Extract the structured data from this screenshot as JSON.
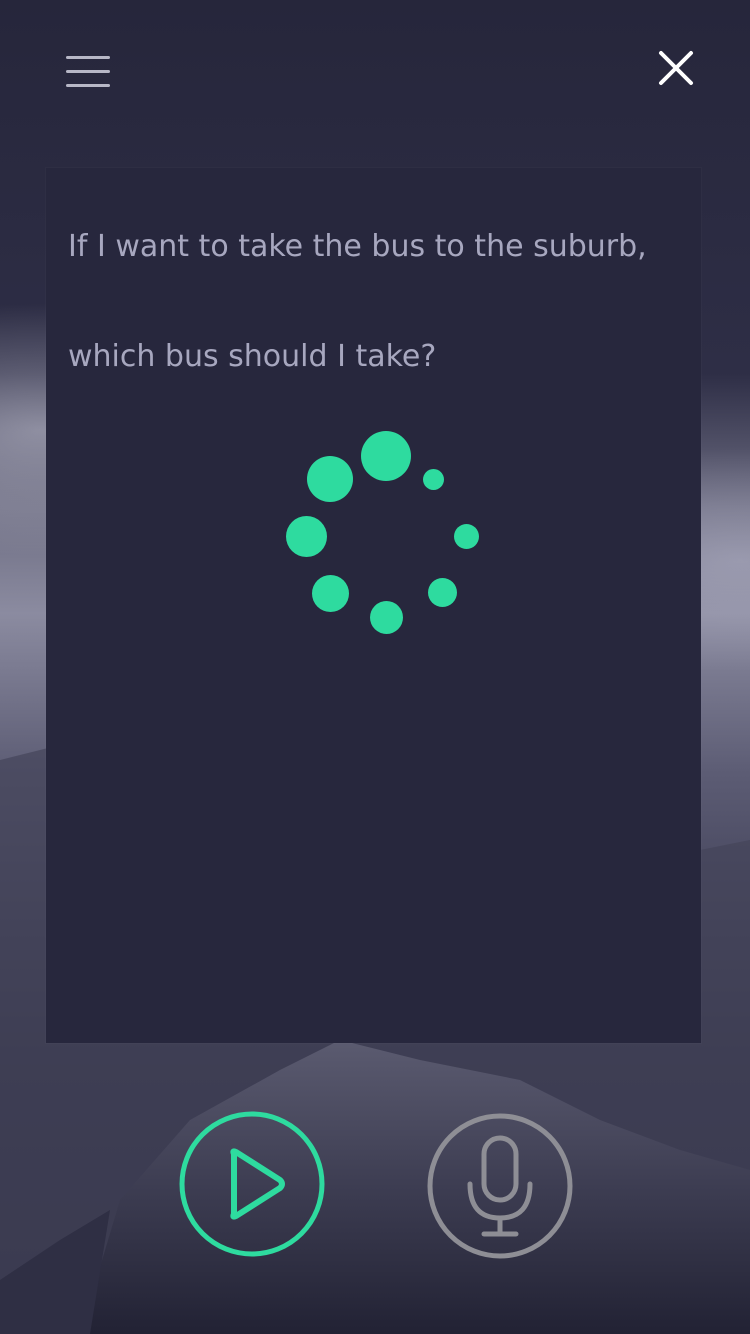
{
  "assistant": {
    "query_lines": [
      "If I want to take the bus to the suburb,",
      "which bus should I take?"
    ],
    "state": "loading"
  },
  "icons": {
    "menu": "menu-icon",
    "close": "close-icon",
    "play": "play-icon",
    "microphone": "microphone-icon"
  },
  "colors": {
    "accent": "#2edb9f",
    "panel": "#27273d",
    "text": "#a7a7bf",
    "mic_ring": "#8e8e95"
  }
}
